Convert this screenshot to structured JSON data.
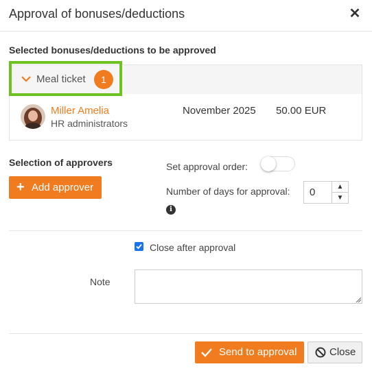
{
  "dialog": {
    "title": "Approval of bonuses/deductions",
    "close_icon": "close-icon"
  },
  "selected": {
    "section_title": "Selected bonuses/deductions to be approved",
    "group": {
      "label": "Meal ticket",
      "count": "1",
      "expanded": true
    },
    "items": [
      {
        "name": "Miller Amelia",
        "department": "HR administrators",
        "period": "November 2025",
        "amount": "50.00 EUR"
      }
    ]
  },
  "approvers": {
    "section_title": "Selection of approvers",
    "add_button_label": "Add approver",
    "set_order_label": "Set approval order:",
    "set_order_enabled": false,
    "days_label": "Number of days for approval:",
    "days_value": "0"
  },
  "options": {
    "close_after_label": "Close after approval",
    "close_after_checked": true,
    "note_label": "Note",
    "note_value": ""
  },
  "footer": {
    "send_label": "Send to approval",
    "close_label": "Close"
  },
  "colors": {
    "accent": "#f07c1f",
    "highlight": "#6dc21f",
    "checkbox": "#1a73e8"
  }
}
